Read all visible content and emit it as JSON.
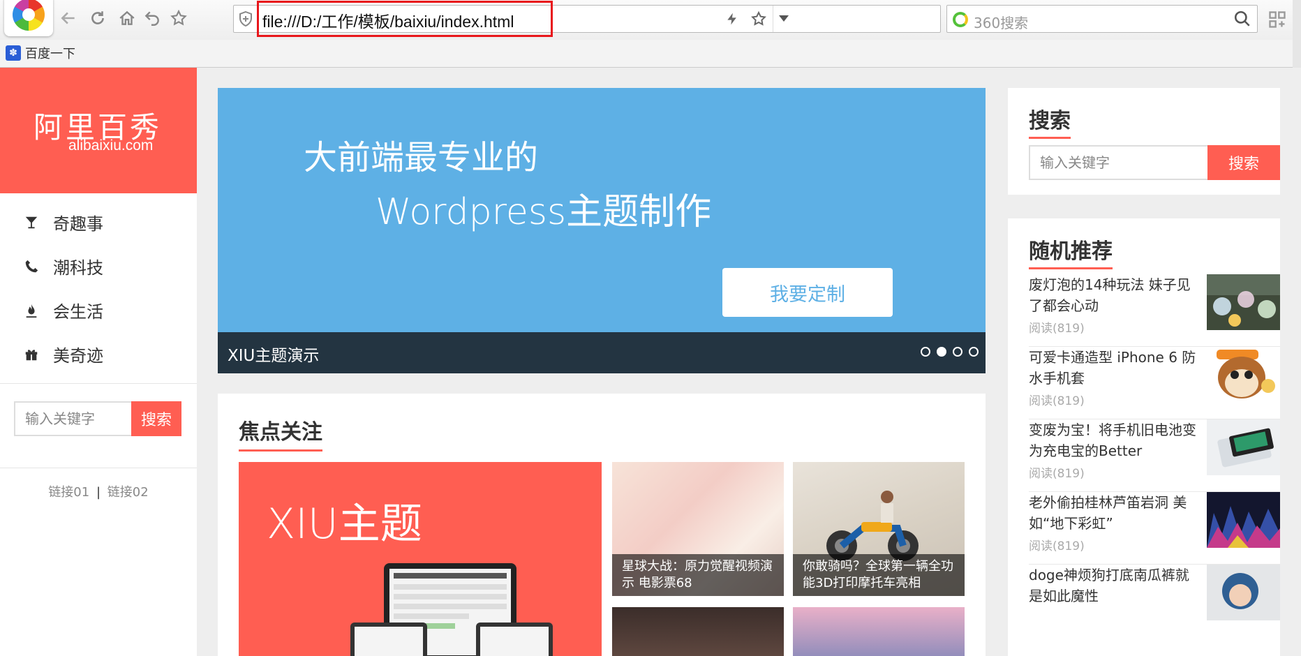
{
  "browser": {
    "url": "file:///D:/工作/模板/baixiu/index.html",
    "search_placeholder": "360搜索",
    "bookmark": "百度一下"
  },
  "sidebar": {
    "logo_cn": "阿里百秀",
    "logo_en": "alibaixiu.com",
    "nav": [
      {
        "label": "奇趣事",
        "icon": "glass-icon"
      },
      {
        "label": "潮科技",
        "icon": "phone-icon"
      },
      {
        "label": "会生活",
        "icon": "fire-icon"
      },
      {
        "label": "美奇迹",
        "icon": "gift-icon"
      }
    ],
    "search_placeholder": "输入关键字",
    "search_button": "搜索",
    "link1": "链接01",
    "link_sep": "|",
    "link2": "链接02"
  },
  "slider": {
    "line1": "大前端最专业的",
    "line2": "Wordpress主题制作",
    "button": "我要定制",
    "caption": "XIU主题演示",
    "dot_count": 4,
    "active_dot": 2
  },
  "focus": {
    "title": "焦点关注",
    "big_card_title": "XIU主题",
    "cards": [
      {
        "caption": "星球大战：原力觉醒视频演示 电影票68"
      },
      {
        "caption": "你敢骑吗？全球第一辆全功能3D打印摩托车亮相"
      }
    ]
  },
  "widgets": {
    "search_title": "搜索",
    "search_placeholder": "输入关键字",
    "search_button": "搜索",
    "random_title": "随机推荐",
    "items": [
      {
        "title": "废灯泡的14种玩法 妹子见了都会心动",
        "meta": "阅读(819)"
      },
      {
        "title": "可爱卡通造型 iPhone 6 防水手机套",
        "meta": "阅读(819)"
      },
      {
        "title": "变废为宝！将手机旧电池变为充电宝的Better",
        "meta": "阅读(819)"
      },
      {
        "title": "老外偷拍桂林芦笛岩洞 美如“地下彩虹”",
        "meta": "阅读(819)"
      },
      {
        "title": "doge神烦狗打底南瓜裤就是如此魔性",
        "meta": ""
      }
    ]
  },
  "colors": {
    "accent": "#ff5e52",
    "slider_bg": "#5eb0e5",
    "caption_bg": "#233441",
    "address_highlight": "#e8161b"
  }
}
